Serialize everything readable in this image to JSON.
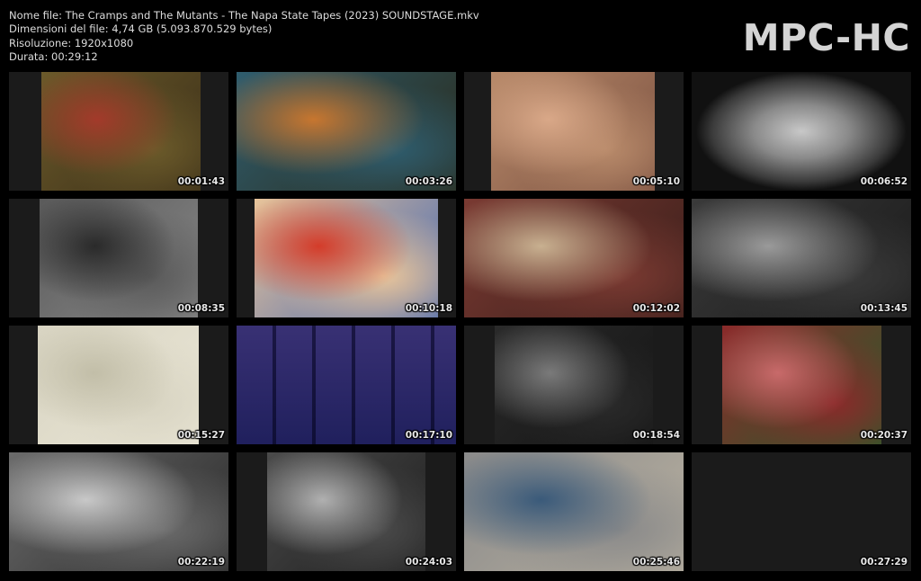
{
  "file_info": {
    "name": "Nome file: The Cramps and The Mutants - The Napa State Tapes (2023) SOUNDSTAGE.mkv",
    "size": "Dimensioni del file: 4,74 GB (5.093.870.529 bytes)",
    "resolution": "Risoluzione: 1920x1080",
    "duration": "Durata: 00:29:12"
  },
  "logo": "MPC-HC",
  "thumbnails": [
    {
      "time": "00:01:43",
      "colors": [
        "#6b5a2a",
        "#a33a2a",
        "#3a2e18"
      ]
    },
    {
      "time": "00:03:26",
      "colors": [
        "#2f5d6e",
        "#c7762f",
        "#2a2a1a"
      ]
    },
    {
      "time": "00:05:10",
      "colors": [
        "#b88a6a",
        "#d9a888",
        "#7a5040"
      ]
    },
    {
      "time": "00:06:52",
      "colors": [
        "#8a8a8a",
        "#c8c8c8",
        "#3a3a3a"
      ]
    },
    {
      "time": "00:08:35",
      "colors": [
        "#5a5a5a",
        "#2a2a2a",
        "#888888"
      ]
    },
    {
      "time": "00:10:18",
      "colors": [
        "#e8c49a",
        "#d43c2a",
        "#4a6ab0"
      ]
    },
    {
      "time": "00:12:02",
      "colors": [
        "#7a3a32",
        "#c8b090",
        "#3a1e1a"
      ]
    },
    {
      "time": "00:13:45",
      "colors": [
        "#3a3a3a",
        "#9a9a9a",
        "#1a1a1a"
      ]
    },
    {
      "time": "00:15:27",
      "colors": [
        "#d8d4c2",
        "#c2bea8",
        "#eae6d6"
      ]
    },
    {
      "time": "00:17:10",
      "colors": [
        "#5a5a9a",
        "#a08ac0",
        "#2a2a5a"
      ]
    },
    {
      "time": "00:18:54",
      "colors": [
        "#2a2a2a",
        "#7a7a7a",
        "#141414"
      ]
    },
    {
      "time": "00:20:37",
      "colors": [
        "#8a2a2a",
        "#c86a6a",
        "#2a5a2a"
      ]
    },
    {
      "time": "00:22:19",
      "colors": [
        "#6a6a6a",
        "#c8c8c8",
        "#2a2a2a"
      ]
    },
    {
      "time": "00:24:03",
      "colors": [
        "#4a4a4a",
        "#b0b0b0",
        "#1e1e1e"
      ]
    },
    {
      "time": "00:25:46",
      "colors": [
        "#8a8a8a",
        "#3a5a7a",
        "#b8b0a0"
      ]
    },
    {
      "time": "00:27:29",
      "colors": [
        "#1b1b1b",
        "#1b1b1b",
        "#1b1b1b"
      ]
    }
  ]
}
